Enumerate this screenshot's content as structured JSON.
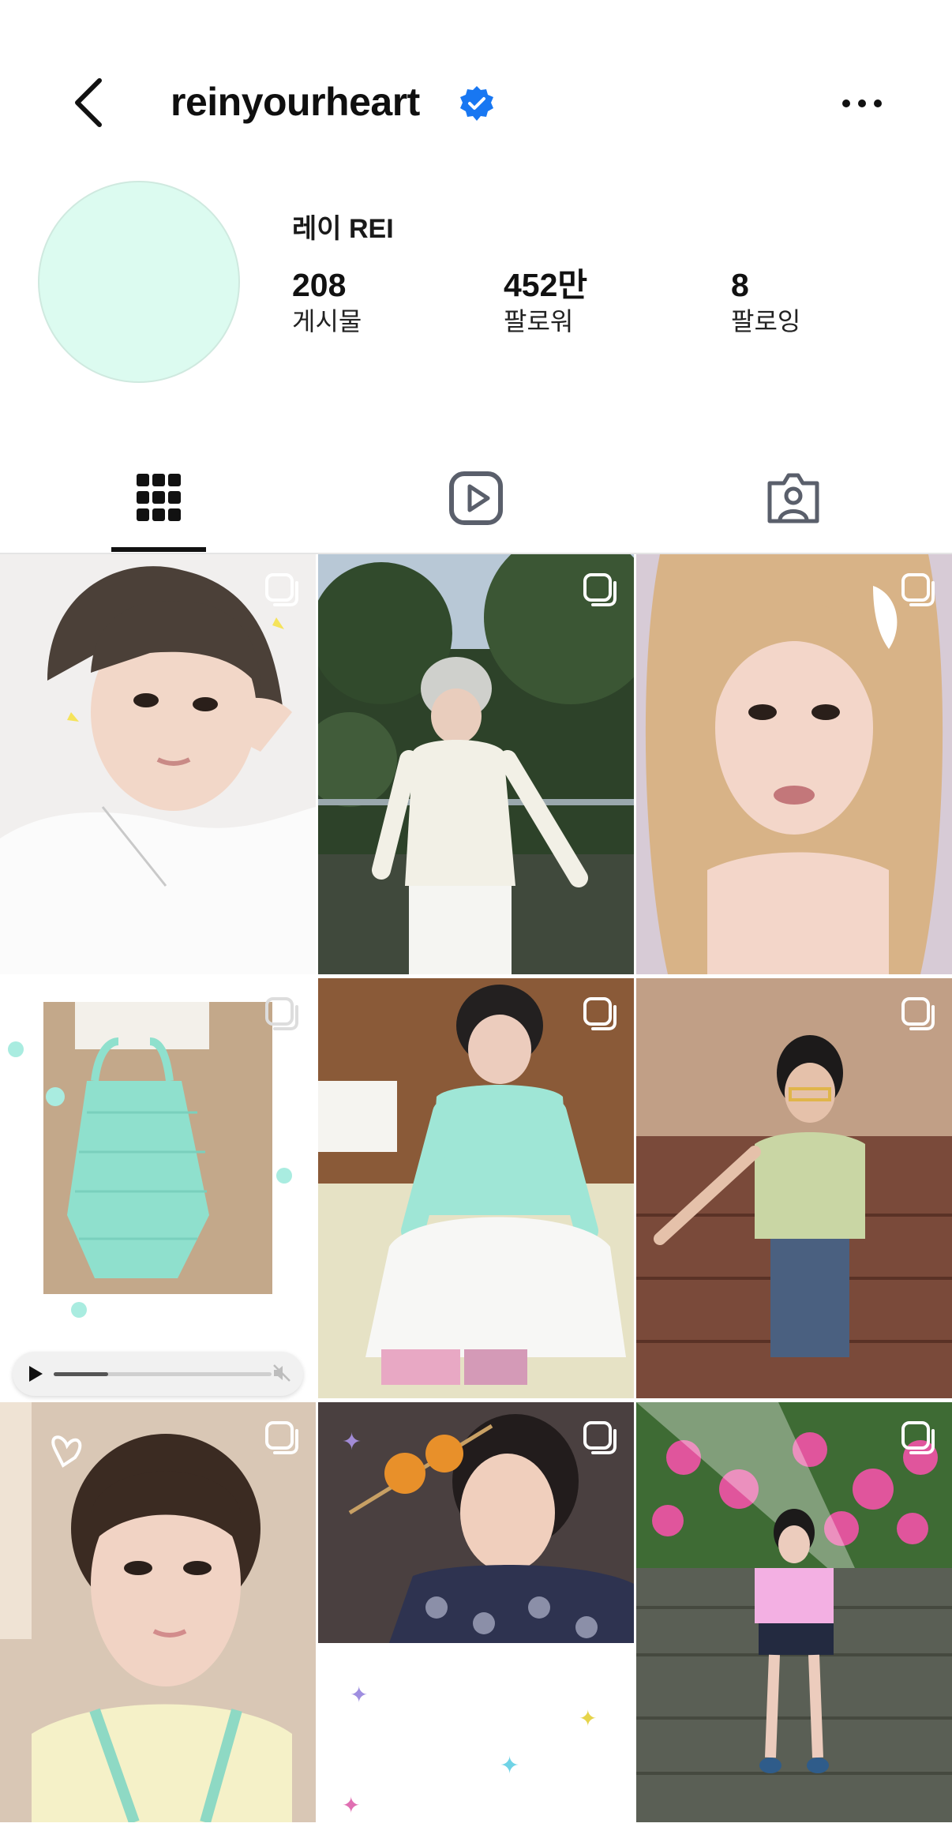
{
  "header": {
    "username": "reinyourheart",
    "verified": true,
    "back_icon": "chevron-left-icon",
    "more_icon": "more-horizontal-icon"
  },
  "profile": {
    "display_name": "레이 REI",
    "avatar_color": "#dcfbf0",
    "stats": [
      {
        "value": "208",
        "label": "게시물"
      },
      {
        "value": "452만",
        "label": "팔로워"
      },
      {
        "value": "8",
        "label": "팔로잉"
      }
    ]
  },
  "tabs": [
    {
      "name": "posts",
      "icon": "grid-icon",
      "active": true
    },
    {
      "name": "reels",
      "icon": "reels-icon",
      "active": false
    },
    {
      "name": "tagged",
      "icon": "tagged-icon",
      "active": false
    }
  ],
  "posts": [
    {
      "desc": "selfie",
      "multi": true
    },
    {
      "desc": "outdoor",
      "multi": true
    },
    {
      "desc": "closeup",
      "multi": true
    },
    {
      "desc": "bag",
      "multi": true,
      "video": true
    },
    {
      "desc": "sitting",
      "multi": true
    },
    {
      "desc": "stairs",
      "multi": true
    },
    {
      "desc": "selfie2",
      "multi": true
    },
    {
      "desc": "tanghulu",
      "multi": true
    },
    {
      "desc": "garden",
      "multi": true
    }
  ],
  "player": {
    "progress": 0.25
  },
  "colors": {
    "accent": "#1877f2",
    "text": "#111111"
  }
}
